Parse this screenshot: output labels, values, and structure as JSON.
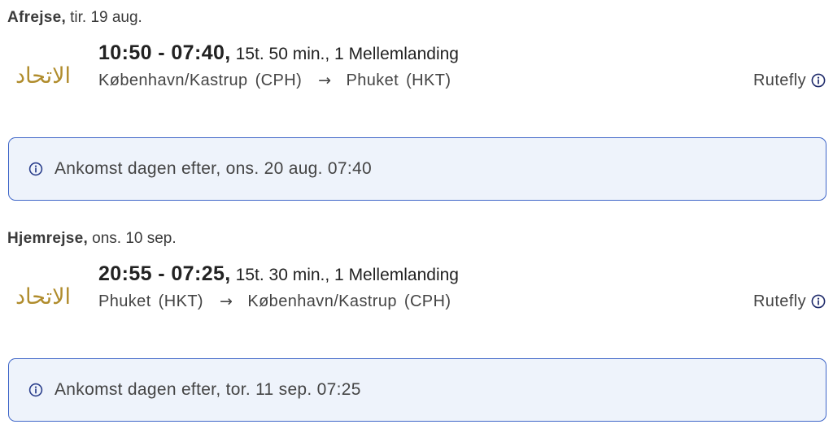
{
  "itinerary": {
    "segments": [
      {
        "direction": "Afrejse,",
        "date": "tir. 19 aug.",
        "airline_logo_text": "الاتحاد",
        "times": "10:50 - 07:40,",
        "duration_stops": "15t. 50 min., 1 Mellemlanding",
        "origin_name": "København/Kastrup",
        "origin_code": "(CPH)",
        "arrow": "→",
        "destination_name": "Phuket",
        "destination_code": "(HKT)",
        "flight_type": "Rutefly",
        "notice_text": "Ankomst dagen efter, ons. 20 aug. 07:40"
      },
      {
        "direction": "Hjemrejse,",
        "date": "ons. 10 sep.",
        "airline_logo_text": "الاتحاد",
        "times": "20:55 - 07:25,",
        "duration_stops": "15t. 30 min., 1 Mellemlanding",
        "origin_name": "Phuket",
        "origin_code": "(HKT)",
        "arrow": "→",
        "destination_name": "København/Kastrup",
        "destination_code": "(CPH)",
        "flight_type": "Rutefly",
        "notice_text": "Ankomst dagen efter, tor. 11 sep. 07:25"
      }
    ]
  },
  "icons": {
    "flight_type_info": "info-circle-icon",
    "notice": "info-circle-icon",
    "airline_logo": "airline-logo"
  },
  "colors": {
    "text_primary": "#222222",
    "text_secondary": "#444444",
    "logo_gold": "#b08c2c",
    "notice_border": "#3f66c8",
    "notice_background": "#eef3fb",
    "icon_navy": "#1f2b6b"
  }
}
